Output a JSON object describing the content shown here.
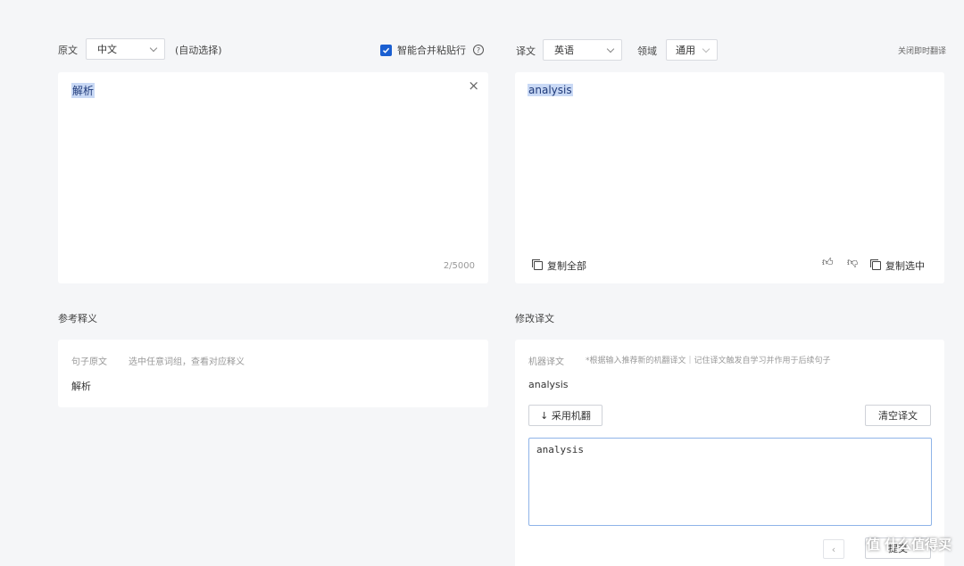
{
  "source": {
    "label": "原文",
    "lang_selected": "中文",
    "auto_select_label": "(自动选择)",
    "smart_merge_label": "智能合并粘贴行",
    "smart_merge_checked": true,
    "text": "解析",
    "char_count": "2/5000"
  },
  "target": {
    "label": "译文",
    "lang_selected": "英语",
    "domain_label": "领域",
    "domain_selected": "通用",
    "close_realtime_label": "关闭即时翻译",
    "text": "analysis",
    "copy_all_label": "复制全部",
    "copy_selected_label": "复制选中"
  },
  "reference": {
    "section_title": "参考释义",
    "col_sentence": "句子原文",
    "col_hint": "选中任意词组，查看对应释义",
    "value": "解析"
  },
  "edit": {
    "section_title": "修改译文",
    "machine_label": "机器译文",
    "machine_hint": "*根据输入推荐新的机翻译文｜记住译文触发自学习并作用于后续句子",
    "machine_value": "analysis",
    "adopt_button": "↓ 采用机翻",
    "clear_button": "清空译文",
    "textarea_value": "analysis",
    "submit_button": "提交"
  },
  "watermark": "值 什么值得买",
  "colors": {
    "accent": "#1a5fd1",
    "highlight": "#c9d9f5",
    "border": "#d9dbe0",
    "textarea_border": "#8fb4e8"
  }
}
